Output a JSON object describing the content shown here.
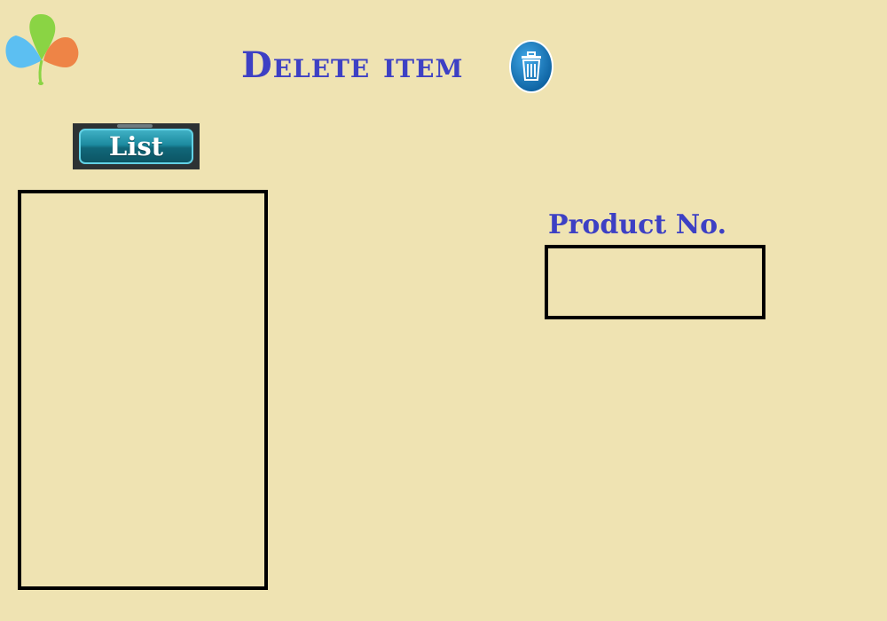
{
  "header": {
    "title": "Delete item",
    "delete_icon": "trash-icon"
  },
  "logo": {
    "icon": "app-logo-balloons",
    "colors": [
      "#8ad444",
      "#5cbff2",
      "#ee8446"
    ]
  },
  "list_panel": {
    "button_label": "List",
    "items": []
  },
  "product": {
    "label": "Product No.",
    "value": "",
    "placeholder": ""
  },
  "colors": {
    "background": "#efe3b2",
    "title": "#3d40c4",
    "button": "#1c8a9f"
  }
}
